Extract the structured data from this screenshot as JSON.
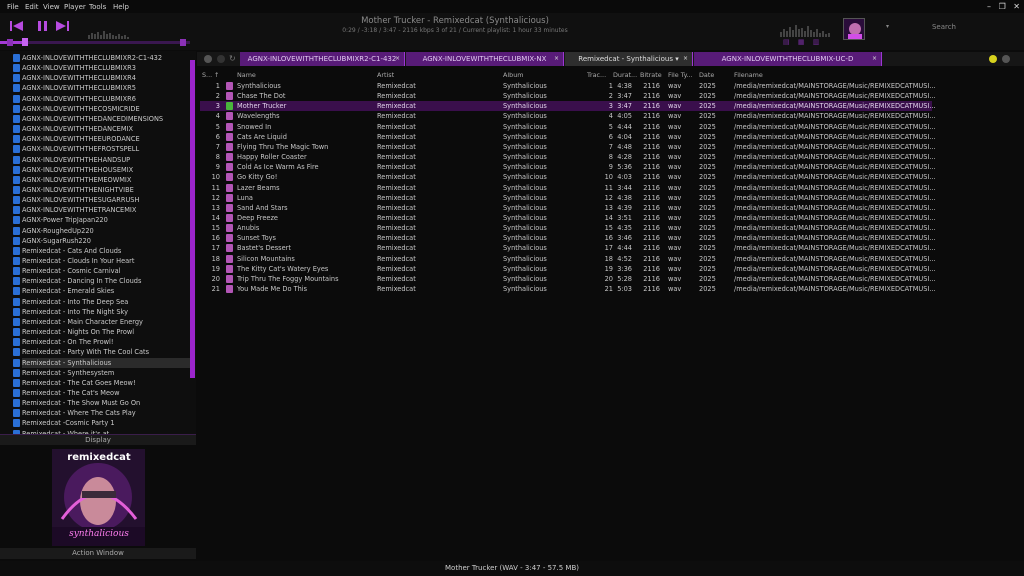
{
  "menu": [
    "File",
    "Edit",
    "View",
    "Player",
    "Tools",
    "Help"
  ],
  "window_controls": [
    "–",
    "❐",
    "✕"
  ],
  "now_playing": {
    "title": "Mother Trucker - Remixedcat  (Synthalicious)",
    "info": "0:29 / -3:18 / 3:47 - 2116 kbps   3 of 21 / Current  playlist:  1 hour 33 minutes",
    "progress_fraction": 0.13
  },
  "search_placeholder": "Search",
  "sidebar": {
    "items": [
      "AGNX-INLOVEWITHTHECLUBMIXR2-C1-432",
      "AGNX-INLOVEWITHTHECLUBMIXR3",
      "AGNX-INLOVEWITHTHECLUBMIXR4",
      "AGNX-INLOVEWITHTHECLUBMIXR5",
      "AGNX-INLOVEWITHTHECLUBMIXR6",
      "AGNX-INLOVEWITHTHECOSMICRIDE",
      "AGNX-INLOVEWITHTHEDANCEDIMENSIONS",
      "AGNX-INLOVEWITHTHEDANCEMIX",
      "AGNX-INLOVEWITHTHEEURODANCE",
      "AGNX-INLOVEWITHTHEFROSTSPELL",
      "AGNX-INLOVEWITHTHEHANDSUP",
      "AGNX-INLOVEWITHTHEHOUSEMIX",
      "AGNX-INLOVEWITHTHEMEOWMIX",
      "AGNX-INLOVEWITHTHENIGHTVIBE",
      "AGNX-INLOVEWITHTHESUGARRUSH",
      "AGNX-INLOVEWITHTHETRANCEMIX",
      "AGNX-Power TripJapan220",
      "AGNX-RoughedUp220",
      "AGNX-SugarRush220",
      "Remixedcat - Cats And Clouds",
      "Remixedcat - Clouds In Your Heart",
      "Remixedcat - Cosmic Carnival",
      "Remixedcat - Dancing In The Clouds",
      "Remixedcat - Emerald Skies",
      "Remixedcat - Into The Deep Sea",
      "Remixedcat - Into The Night Sky",
      "Remixedcat - Main Character Energy",
      "Remixedcat - Nights On The Prowl",
      "Remixedcat - On The Prowl!",
      "Remixedcat - Party With The Cool Cats",
      "Remixedcat - Synthalicious",
      "Remixedcat - Synthesystem",
      "Remixedcat - The Cat Goes Meow!",
      "Remixedcat - The Cat's Meow",
      "Remixedcat - The Show Must Go On",
      "Remixedcat - Where The Cats Play",
      "Remixedcat -Cosmic Party 1",
      "Remixedcat - Where it's at"
    ],
    "selected_index": 30,
    "display_label": "Display",
    "action_label": "Action Window",
    "art_text": "remixedcat",
    "art_caption": "synthalicious"
  },
  "tabs": [
    {
      "label": "AGNX-INLOVEWITHTHECLUBMIXR2-C1-432",
      "close": "×"
    },
    {
      "label": "AGNX-INLOVEWITHTHECLUBMIX-NX",
      "close": "×"
    },
    {
      "label": "Remixedcat - Synthalicious  ▾",
      "close": "×"
    },
    {
      "label": "AGNX-INLOVEWITHTHECLUBMIX-UC-D",
      "close": "×"
    }
  ],
  "columns": [
    "S...",
    "↑",
    "Name",
    "Artist",
    "Album",
    "Trac...",
    "Durat...",
    "Bitrate",
    "File Ty...",
    "Date",
    "Filename"
  ],
  "tracks": [
    [
      "1",
      "Synthalicious",
      "Remixedcat",
      "Synthalicious",
      "1",
      "4:38",
      "2116",
      "wav",
      "2025",
      "/media/remixedcat/MAINSTORAGE/Music/REMIXEDCATMUSI..."
    ],
    [
      "2",
      "Chase The Dot",
      "Remixedcat",
      "Synthalicious",
      "2",
      "3:47",
      "2116",
      "wav",
      "2025",
      "/media/remixedcat/MAINSTORAGE/Music/REMIXEDCATMUSI..."
    ],
    [
      "3",
      "Mother Trucker",
      "Remixedcat",
      "Synthalicious",
      "3",
      "3:47",
      "2116",
      "wav",
      "2025",
      "/media/remixedcat/MAINSTORAGE/Music/REMIXEDCATMUSI..."
    ],
    [
      "4",
      "Wavelengths",
      "Remixedcat",
      "Synthalicious",
      "4",
      "4:05",
      "2116",
      "wav",
      "2025",
      "/media/remixedcat/MAINSTORAGE/Music/REMIXEDCATMUSI..."
    ],
    [
      "5",
      "Snowed In",
      "Remixedcat",
      "Synthalicious",
      "5",
      "4:44",
      "2116",
      "wav",
      "2025",
      "/media/remixedcat/MAINSTORAGE/Music/REMIXEDCATMUSI..."
    ],
    [
      "6",
      "Cats Are Liquid",
      "Remixedcat",
      "Synthalicious",
      "6",
      "4:04",
      "2116",
      "wav",
      "2025",
      "/media/remixedcat/MAINSTORAGE/Music/REMIXEDCATMUSI..."
    ],
    [
      "7",
      "Flying Thru The Magic Town",
      "Remixedcat",
      "Synthalicious",
      "7",
      "4:48",
      "2116",
      "wav",
      "2025",
      "/media/remixedcat/MAINSTORAGE/Music/REMIXEDCATMUSI..."
    ],
    [
      "8",
      "Happy Roller Coaster",
      "Remixedcat",
      "Synthalicious",
      "8",
      "4:28",
      "2116",
      "wav",
      "2025",
      "/media/remixedcat/MAINSTORAGE/Music/REMIXEDCATMUSI..."
    ],
    [
      "9",
      "Cold As Ice Warm As Fire",
      "Remixedcat",
      "Synthalicious",
      "9",
      "5:36",
      "2116",
      "wav",
      "2025",
      "/media/remixedcat/MAINSTORAGE/Music/REMIXEDCATMUSI..."
    ],
    [
      "10",
      "Go Kitty Go!",
      "Remixedcat",
      "Synthalicious",
      "10",
      "4:03",
      "2116",
      "wav",
      "2025",
      "/media/remixedcat/MAINSTORAGE/Music/REMIXEDCATMUSI..."
    ],
    [
      "11",
      "Lazer Beams",
      "Remixedcat",
      "Synthalicious",
      "11",
      "3:44",
      "2116",
      "wav",
      "2025",
      "/media/remixedcat/MAINSTORAGE/Music/REMIXEDCATMUSI..."
    ],
    [
      "12",
      "Luna",
      "Remixedcat",
      "Synthalicious",
      "12",
      "4:38",
      "2116",
      "wav",
      "2025",
      "/media/remixedcat/MAINSTORAGE/Music/REMIXEDCATMUSI..."
    ],
    [
      "13",
      "Sand And Stars",
      "Remixedcat",
      "Synthalicious",
      "13",
      "4:39",
      "2116",
      "wav",
      "2025",
      "/media/remixedcat/MAINSTORAGE/Music/REMIXEDCATMUSI..."
    ],
    [
      "14",
      "Deep Freeze",
      "Remixedcat",
      "Synthalicious",
      "14",
      "3:51",
      "2116",
      "wav",
      "2025",
      "/media/remixedcat/MAINSTORAGE/Music/REMIXEDCATMUSI..."
    ],
    [
      "15",
      "Anubis",
      "Remixedcat",
      "Synthalicious",
      "15",
      "4:35",
      "2116",
      "wav",
      "2025",
      "/media/remixedcat/MAINSTORAGE/Music/REMIXEDCATMUSI..."
    ],
    [
      "16",
      "Sunset Toys",
      "Remixedcat",
      "Synthalicious",
      "16",
      "3:46",
      "2116",
      "wav",
      "2025",
      "/media/remixedcat/MAINSTORAGE/Music/REMIXEDCATMUSI..."
    ],
    [
      "17",
      "Bastet's Dessert",
      "Remixedcat",
      "Synthalicious",
      "17",
      "4:44",
      "2116",
      "wav",
      "2025",
      "/media/remixedcat/MAINSTORAGE/Music/REMIXEDCATMUSI..."
    ],
    [
      "18",
      "Silicon Mountains",
      "Remixedcat",
      "Synthalicious",
      "18",
      "4:52",
      "2116",
      "wav",
      "2025",
      "/media/remixedcat/MAINSTORAGE/Music/REMIXEDCATMUSI..."
    ],
    [
      "19",
      "The Kitty Cat's Watery Eyes",
      "Remixedcat",
      "Synthalicious",
      "19",
      "3:36",
      "2116",
      "wav",
      "2025",
      "/media/remixedcat/MAINSTORAGE/Music/REMIXEDCATMUSI..."
    ],
    [
      "20",
      "Trip Thru The Foggy Mountains",
      "Remixedcat",
      "Synthalicious",
      "20",
      "5:28",
      "2116",
      "wav",
      "2025",
      "/media/remixedcat/MAINSTORAGE/Music/REMIXEDCATMUSI..."
    ],
    [
      "21",
      "You Made Me Do This",
      "Remixedcat",
      "Synthalicious",
      "21",
      "5:03",
      "2116",
      "wav",
      "2025",
      "/media/remixedcat/MAINSTORAGE/Music/REMIXEDCATMUSI..."
    ]
  ],
  "selected_track_index": 2,
  "status": "Mother Trucker (WAV - 3:47 - 57.5 MB)",
  "colors": {
    "accent": "#9b25cc",
    "tab": "#581b78",
    "selected_row": "#3a0f4c",
    "folder_icon": "#2a6fd6",
    "track_icon": "#b356b6",
    "playing_icon": "#49b53c"
  }
}
